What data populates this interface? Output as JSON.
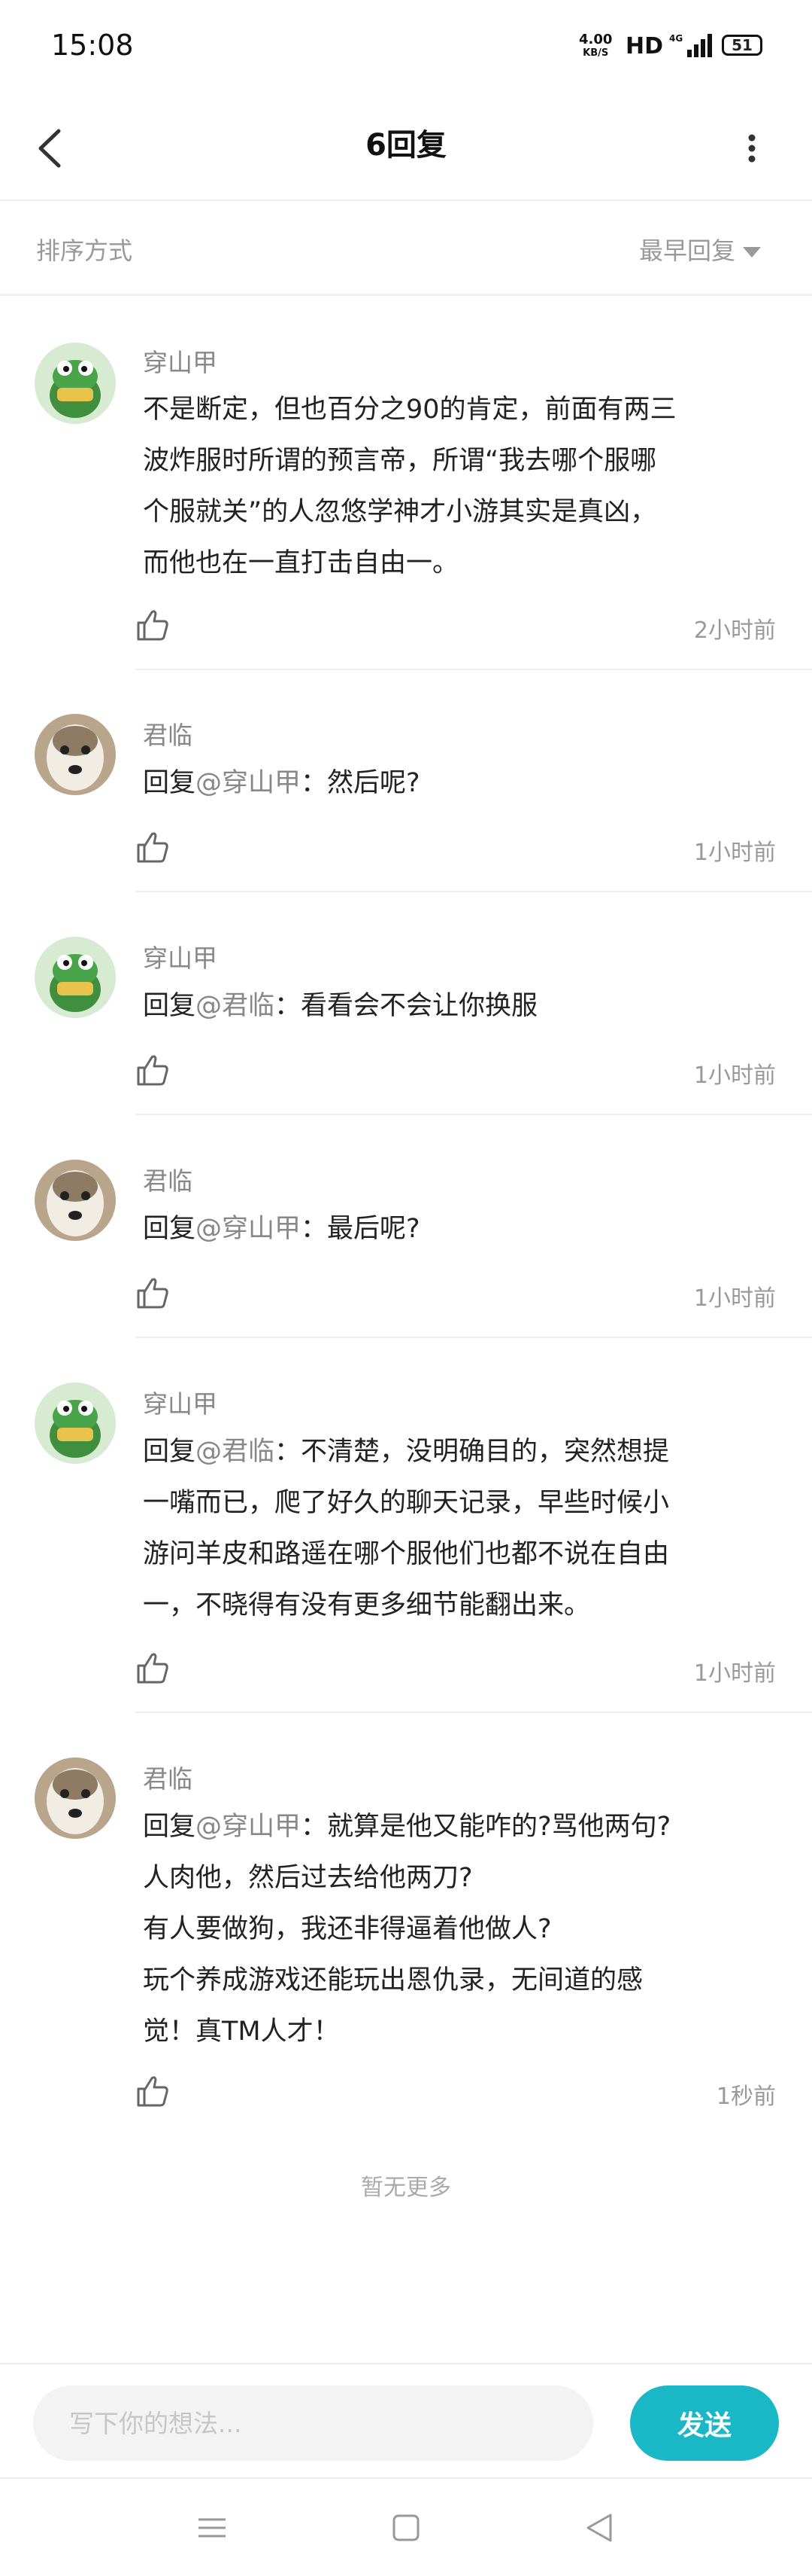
{
  "status_bar": {
    "time": "15:08",
    "net_speed_value": "4.00",
    "net_speed_unit": "KB/S",
    "hd": "HD",
    "signal": "4G",
    "battery": "51"
  },
  "header": {
    "title": "6回复",
    "back_icon": "back-arrow-icon",
    "more_icon": "more-vertical-icon"
  },
  "sort": {
    "label": "排序方式",
    "selected": "最早回复"
  },
  "comments": [
    {
      "author": "穿山甲",
      "avatar": "green-frog-avatar",
      "reply_prefix": "",
      "mention": "",
      "text_lines": [
        "不是断定，但也百分之90的肯定，前面有两三",
        "波炸服时所谓的预言帝，所谓“我去哪个服哪",
        "个服就关”的人忽悠学神才小游其实是真凶，",
        "而他也在一直打击自由一。"
      ],
      "time": "2小时前"
    },
    {
      "author": "君临",
      "avatar": "dog-avatar",
      "reply_prefix": "回复",
      "mention": "@穿山甲",
      "text_lines": [
        "：然后呢?"
      ],
      "time": "1小时前"
    },
    {
      "author": "穿山甲",
      "avatar": "green-frog-avatar",
      "reply_prefix": "回复",
      "mention": "@君临",
      "text_lines": [
        "：看看会不会让你换服"
      ],
      "time": "1小时前"
    },
    {
      "author": "君临",
      "avatar": "dog-avatar",
      "reply_prefix": "回复",
      "mention": "@穿山甲",
      "text_lines": [
        "：最后呢?"
      ],
      "time": "1小时前"
    },
    {
      "author": "穿山甲",
      "avatar": "green-frog-avatar",
      "reply_prefix": "回复",
      "mention": "@君临",
      "text_lines": [
        "：不清楚，没明确目的，突然想提",
        "一嘴而已，爬了好久的聊天记录，早些时候小",
        "游问羊皮和路遥在哪个服他们也都不说在自由",
        "一，不晓得有没有更多细节能翻出来。"
      ],
      "time": "1小时前"
    },
    {
      "author": "君临",
      "avatar": "dog-avatar",
      "reply_prefix": "回复",
      "mention": "@穿山甲",
      "text_lines": [
        "：就算是他又能咋的?骂他两句?",
        "人肉他，然后过去给他两刀?",
        "有人要做狗，我还非得逼着他做人?",
        "玩个养成游戏还能玩出恩仇录，无间道的感",
        "觉！真TM人才！"
      ],
      "time": "1秒前"
    }
  ],
  "footer_text": "暂无更多",
  "input": {
    "placeholder": "写下你的想法...",
    "value": ""
  },
  "send_label": "发送",
  "colors": {
    "accent": "#1ab7c7",
    "muted_text": "#999999",
    "body_text": "#222222"
  }
}
